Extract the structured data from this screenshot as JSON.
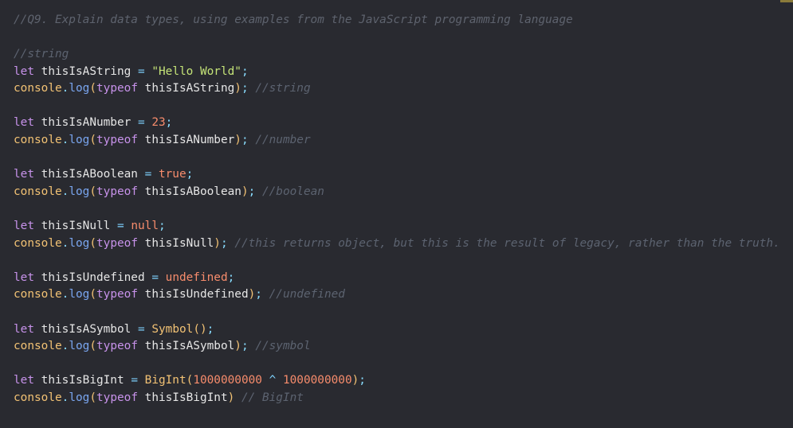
{
  "editor": {
    "header_comment": "//Q9. Explain data types, using examples from the JavaScript programming language",
    "section_comment": "//string",
    "blocks": [
      {
        "keyword": "let",
        "var_name": "thisIsAString",
        "op": "=",
        "value": "\"Hello World\"",
        "value_kind": "string",
        "log_obj": "console",
        "log_fn": "log",
        "typeof": "typeof",
        "comment": "//string"
      },
      {
        "keyword": "let",
        "var_name": "thisIsANumber",
        "op": "=",
        "value": "23",
        "value_kind": "number",
        "log_obj": "console",
        "log_fn": "log",
        "typeof": "typeof",
        "comment": "//number"
      },
      {
        "keyword": "let",
        "var_name": "thisIsABoolean",
        "op": "=",
        "value": "true",
        "value_kind": "literal",
        "log_obj": "console",
        "log_fn": "log",
        "typeof": "typeof",
        "comment": "//boolean"
      },
      {
        "keyword": "let",
        "var_name": "thisIsNull",
        "op": "=",
        "value": "null",
        "value_kind": "literal",
        "log_obj": "console",
        "log_fn": "log",
        "typeof": "typeof",
        "comment": "//this returns object, but this is the result of legacy, rather than the truth."
      },
      {
        "keyword": "let",
        "var_name": "thisIsUndefined",
        "op": "=",
        "value": "undefined",
        "value_kind": "literal",
        "log_obj": "console",
        "log_fn": "log",
        "typeof": "typeof",
        "comment": "//undefined"
      },
      {
        "keyword": "let",
        "var_name": "thisIsASymbol",
        "op": "=",
        "value_fn": "Symbol",
        "value_args": "",
        "log_obj": "console",
        "log_fn": "log",
        "typeof": "typeof",
        "comment": "//symbol"
      },
      {
        "keyword": "let",
        "var_name": "thisIsBigInt",
        "op": "=",
        "value_fn": "BigInt",
        "value_arg1": "1000000000",
        "value_op": "^",
        "value_arg2": "1000000000",
        "log_obj": "console",
        "log_fn": "log",
        "typeof": "typeof",
        "comment": "// BigInt"
      }
    ]
  },
  "colors": {
    "background": "#292a30",
    "keyword": "#c792ea",
    "string": "#c5e478",
    "number": "#f78c6c",
    "function": "#7aa6f0",
    "comment": "#5c6370"
  }
}
